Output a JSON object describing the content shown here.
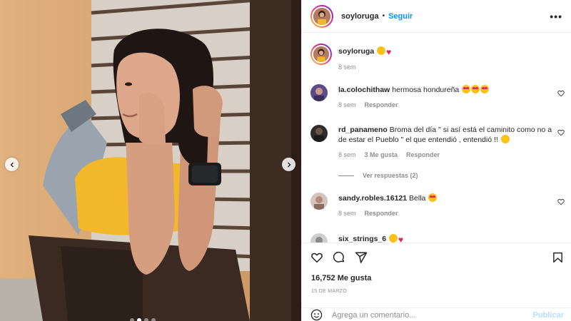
{
  "post": {
    "username": "soyloruga",
    "separator": "•",
    "follow_label": "Seguir",
    "more_icon": "more-horizontal-icon"
  },
  "caption": {
    "username": "soyloruga",
    "time": "8 sem"
  },
  "comments": [
    {
      "username": "la.colochithaw",
      "text": "hermosa hondureña",
      "emojis": [
        "heart-eyes",
        "heart-eyes",
        "heart-eyes"
      ],
      "time": "8 sem",
      "reply": "Responder"
    },
    {
      "username": "rd_panameno",
      "text": "Broma del día \" si así está el caminito como no a de estar el Pueblo \" el que entendió , entendió !!",
      "time": "8 sem",
      "likes": "3 Me gusta",
      "reply": "Responder",
      "view_replies": "Ver respuestas (2)"
    },
    {
      "username": "sandy.robles.16121",
      "text": "Bella",
      "time": "8 sem",
      "reply": "Responder"
    },
    {
      "username": "six_strings_6"
    }
  ],
  "actions": {
    "likes": "16,752 Me gusta",
    "date": "15 DE MARZO",
    "comment_placeholder": "Agrega un comentario...",
    "publish_label": "Publicar"
  },
  "colors": {
    "accent": "#0095f6",
    "publish_disabled": "#b2dffc",
    "muted": "#8e8e8e",
    "text": "#262626"
  }
}
